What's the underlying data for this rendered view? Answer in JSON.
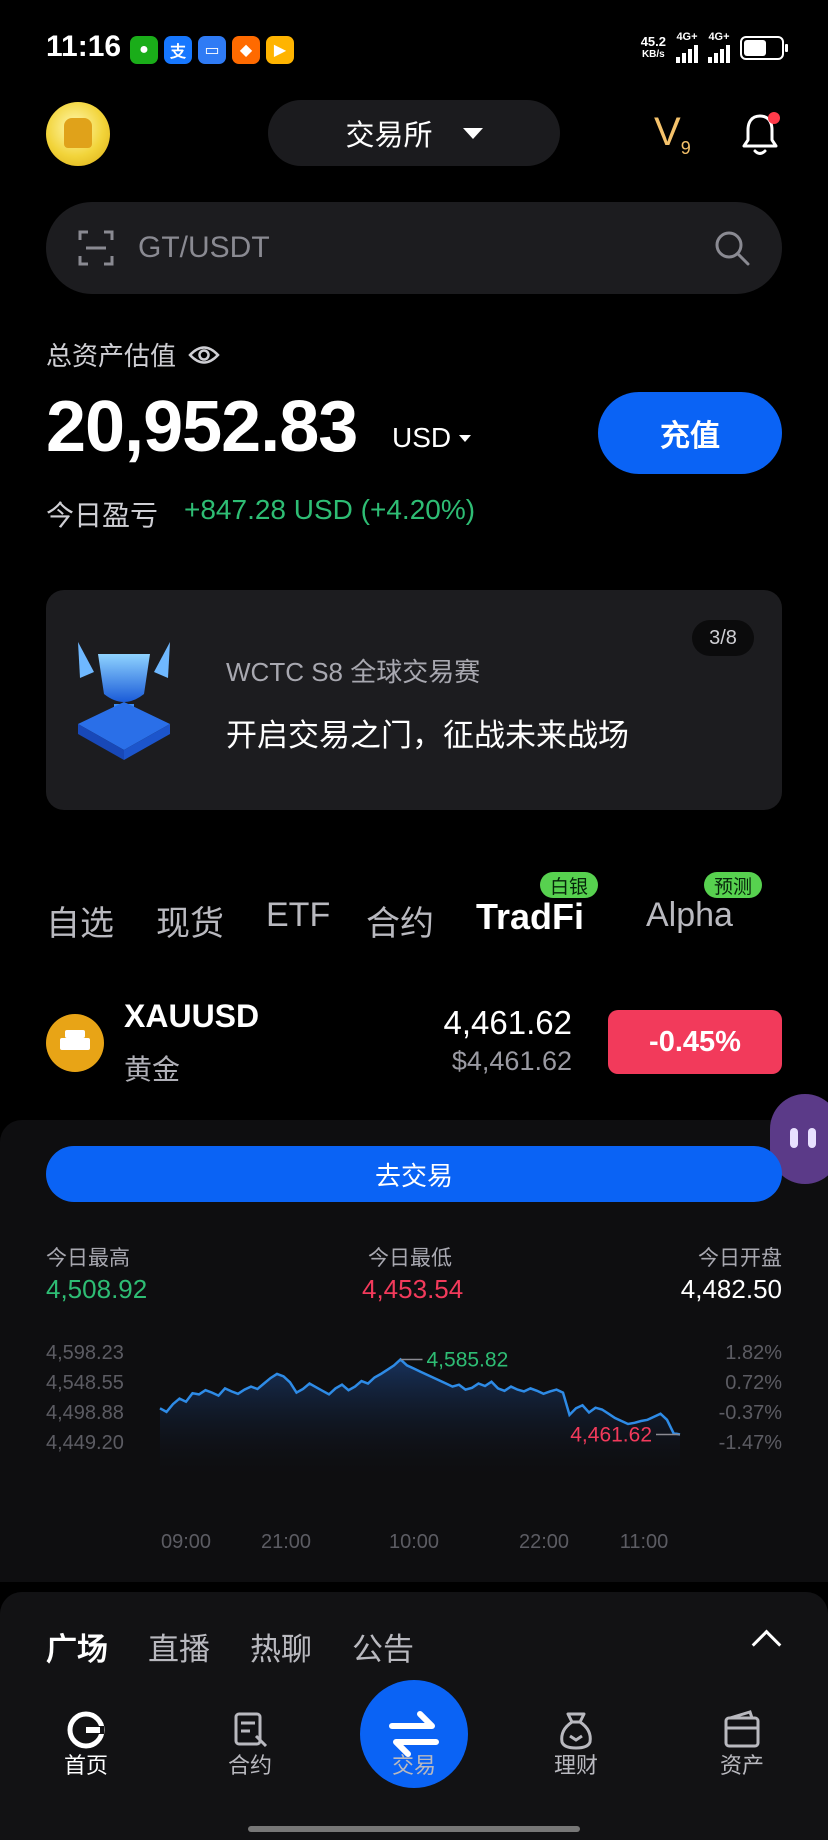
{
  "status_bar": {
    "time": "11:16",
    "net_speed": "45.2",
    "net_unit": "KB/s",
    "sig1": "4G+",
    "sig2": "4G+",
    "app_icons": [
      "wechat-icon",
      "alipay-icon",
      "message-icon",
      "taobao-icon",
      "video-icon"
    ]
  },
  "header": {
    "mode_label": "交易所",
    "vip_level": "V",
    "vip_num": "9"
  },
  "search": {
    "placeholder": "GT/USDT"
  },
  "assets": {
    "label": "总资产估值",
    "value": "20,952.83",
    "currency": "USD",
    "deposit_label": "充值",
    "pnl_label": "今日盈亏",
    "pnl_value": "+847.28 USD (+4.20%)",
    "pnl_color": "#2ebd74"
  },
  "banner": {
    "title": "WCTC S8 全球交易赛",
    "subtitle": "开启交易之门，征战未来战场",
    "page": "3/8"
  },
  "market_tabs": [
    {
      "label": "自选"
    },
    {
      "label": "现货"
    },
    {
      "label": "ETF"
    },
    {
      "label": "合约"
    },
    {
      "label": "TradFi",
      "badge": "白银"
    },
    {
      "label": "Alpha",
      "badge": "预测"
    }
  ],
  "market_row": {
    "symbol": "XAUUSD",
    "name": "黄金",
    "price": "4,461.62",
    "price_usd": "$4,461.62",
    "change": "-0.45%",
    "change_color": "#f23a5b"
  },
  "detail": {
    "trade_button": "去交易",
    "high_label": "今日最高",
    "high_value": "4,508.92",
    "low_label": "今日最低",
    "low_value": "4,453.54",
    "open_label": "今日开盘",
    "open_value": "4,482.50"
  },
  "chart_data": {
    "type": "area",
    "y_ticks": [
      "4,598.23",
      "4,548.55",
      "4,498.88",
      "4,449.20"
    ],
    "y_pct_ticks": [
      "1.82%",
      "0.72%",
      "-0.37%",
      "-1.47%"
    ],
    "x_ticks": [
      "09:00",
      "21:00",
      "10:00",
      "22:00",
      "11:00"
    ],
    "ylim": [
      4449.2,
      4598.23
    ],
    "values": [
      4505,
      4499,
      4512,
      4521,
      4516,
      4530,
      4528,
      4535,
      4531,
      4526,
      4538,
      4533,
      4529,
      4536,
      4541,
      4537,
      4546,
      4555,
      4562,
      4558,
      4548,
      4531,
      4537,
      4546,
      4540,
      4534,
      4528,
      4538,
      4544,
      4535,
      4541,
      4550,
      4546,
      4556,
      4562,
      4569,
      4576,
      4585.82,
      4576,
      4571,
      4566,
      4561,
      4556,
      4551,
      4546,
      4541,
      4544,
      4536,
      4539,
      4546,
      4542,
      4549,
      4538,
      4534,
      4541,
      4536,
      4533,
      4538,
      4534,
      4529,
      4533,
      4536,
      4531,
      4494,
      4505,
      4510,
      4498,
      4506,
      4503,
      4496,
      4489,
      4484,
      4479,
      4481,
      4484,
      4486,
      4491,
      4496,
      4486,
      4464,
      4461.62
    ],
    "max_label": "4,585.82",
    "last_label": "4,461.62",
    "line_color": "#2e8be6",
    "max_color": "#2ebd74",
    "last_color": "#f23a5b"
  },
  "social_tabs": [
    "广场",
    "直播",
    "热聊",
    "公告"
  ],
  "bottom_nav": [
    {
      "label": "首页",
      "icon": "home-icon"
    },
    {
      "label": "合约",
      "icon": "futures-icon"
    },
    {
      "label": "交易",
      "icon": "swap-icon"
    },
    {
      "label": "理财",
      "icon": "earn-icon"
    },
    {
      "label": "资产",
      "icon": "wallet-icon"
    }
  ]
}
